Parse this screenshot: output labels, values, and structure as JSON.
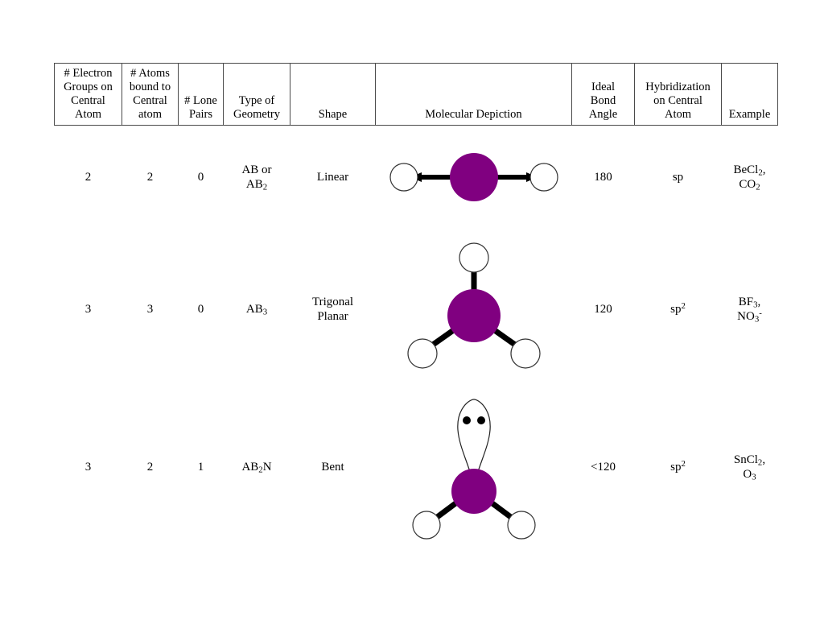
{
  "document": {
    "title": "VSEPR Molecular Geometry Table",
    "accent_color": "#800080",
    "border_color": "#4a4a4a"
  },
  "table": {
    "headers": [
      "# Electron Groups on Central Atom",
      "# Atoms bound to Central atom",
      "# Lone Pairs",
      "Type of Geometry",
      "Shape",
      "Molecular Depiction",
      "Ideal Bond Angle",
      "Hybridization on Central Atom",
      "Example"
    ],
    "header_lines": {
      "groups": [
        "# Electron",
        "Groups on",
        "Central",
        "Atom"
      ],
      "atoms": [
        "# Atoms",
        "bound to",
        "Central",
        "atom"
      ],
      "lone": [
        "# Lone",
        "Pairs"
      ],
      "geomtype": [
        "Type of",
        "Geometry"
      ],
      "shape": [
        "Shape"
      ],
      "depict": [
        "Molecular Depiction"
      ],
      "angle": [
        "Ideal",
        "Bond",
        "Angle"
      ],
      "hybrid": [
        "Hybridization",
        "on Central",
        "Atom"
      ],
      "example": [
        "Example"
      ]
    },
    "rows": [
      {
        "electron_groups": "2",
        "atoms_bound": "2",
        "lone_pairs": "0",
        "geometry_type_line1": "AB or",
        "geometry_type_line2_base": "AB",
        "geometry_type_line2_sub": "2",
        "shape_line1": "Linear",
        "shape_line2": "",
        "depiction": "linear-molecule-diagram",
        "bond_angle": "180",
        "hybridization_base": "sp",
        "hybridization_sup": "",
        "example_1_base": "BeCl",
        "example_1_sub": "2",
        "example_1_tail": ",",
        "example_2_base": "CO",
        "example_2_sub": "2",
        "example_2_sup": ""
      },
      {
        "electron_groups": "3",
        "atoms_bound": "3",
        "lone_pairs": "0",
        "geometry_type_line1": "",
        "geometry_type_line2_base": "AB",
        "geometry_type_line2_sub": "3",
        "shape_line1": "Trigonal",
        "shape_line2": "Planar",
        "depiction": "trigonal-planar-molecule-diagram",
        "bond_angle": "120",
        "hybridization_base": "sp",
        "hybridization_sup": "2",
        "example_1_base": "BF",
        "example_1_sub": "3",
        "example_1_tail": ",",
        "example_2_base": "NO",
        "example_2_sub": "3",
        "example_2_sup": "-"
      },
      {
        "electron_groups": "3",
        "atoms_bound": "2",
        "lone_pairs": "1",
        "geometry_type_line1": "",
        "geometry_type_line2_base": "AB",
        "geometry_type_line2_sub": "2",
        "geometry_type_line2_tail": "N",
        "shape_line1": "Bent",
        "shape_line2": "",
        "depiction": "bent-molecule-diagram",
        "bond_angle": "<120",
        "hybridization_base": "sp",
        "hybridization_sup": "2",
        "example_1_base": "SnCl",
        "example_1_sub": "2",
        "example_1_tail": ",",
        "example_2_base": "O",
        "example_2_sub": "3",
        "example_2_sup": ""
      }
    ]
  }
}
